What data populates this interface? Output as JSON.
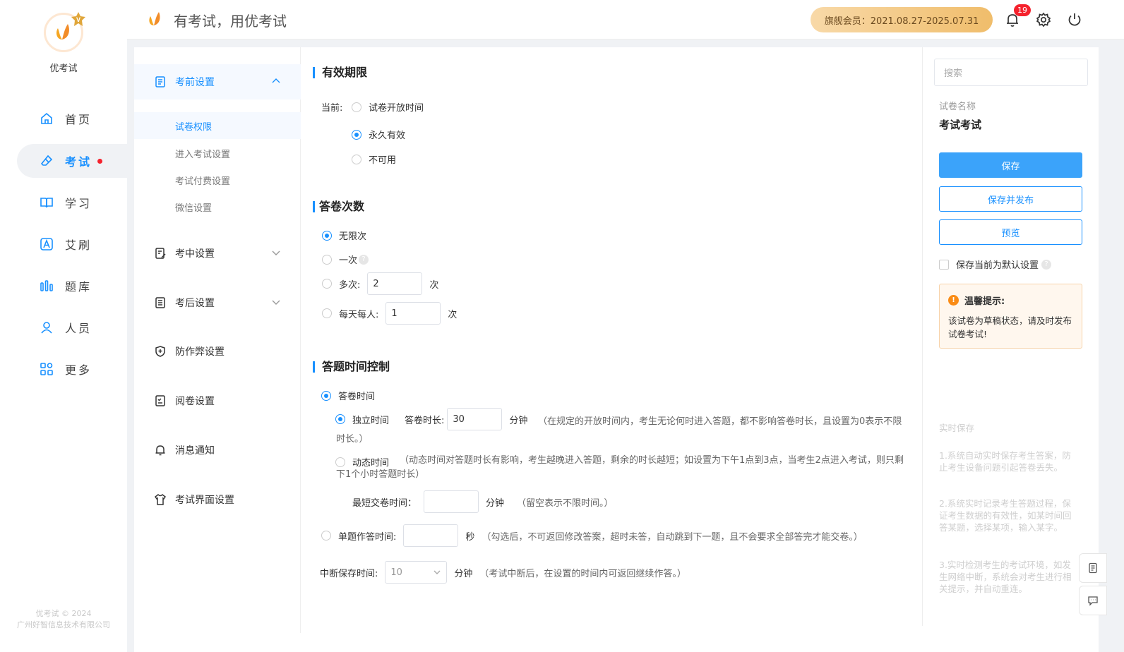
{
  "app": {
    "brand": "优考试",
    "slogan": "有考试，用优考试",
    "vip_text": "旗舰会员：2021.08.27-2025.07.31",
    "notification_count": "19",
    "copyright_line1": "优考试 © 2024",
    "copyright_line2": "广州好智信息技术有限公司",
    "accent_color": "#1890ff"
  },
  "nav": {
    "items": [
      {
        "label": "首页",
        "icon": "home-icon"
      },
      {
        "label": "考试",
        "icon": "eraser-icon"
      },
      {
        "label": "学习",
        "icon": "book-icon"
      },
      {
        "label": "艾刷",
        "icon": "a-icon"
      },
      {
        "label": "题库",
        "icon": "bar-chart-icon"
      },
      {
        "label": "人员",
        "icon": "user-icon"
      },
      {
        "label": "更多",
        "icon": "grid-icon"
      }
    ]
  },
  "submenu": {
    "before": "考前设置",
    "before_items": [
      "试卷权限",
      "进入考试设置",
      "考试付费设置",
      "微信设置"
    ],
    "during": "考中设置",
    "after": "考后设置",
    "anticheat": "防作弊设置",
    "grading": "阅卷设置",
    "notify": "消息通知",
    "ui": "考试界面设置"
  },
  "validity": {
    "title": "有效期限",
    "current_label": "当前:",
    "options": [
      "试卷开放时间",
      "永久有效",
      "不可用"
    ],
    "selected": "永久有效"
  },
  "attempts": {
    "title": "答卷次数",
    "unlimited": "无限次",
    "once": "一次",
    "multi": "多次:",
    "multi_value": "2",
    "multi_unit": "次",
    "daily": "每天每人:",
    "daily_value": "1",
    "daily_unit": "次",
    "selected": "无限次"
  },
  "timing": {
    "title": "答题时间控制",
    "answer_time": "答卷时间",
    "independent": "独立时间",
    "duration_label": "答卷时长:",
    "duration_value": "30",
    "duration_unit": "分钟",
    "independent_hint": "（在规定的开放时间内，考生无论何时进入答题，都不影响答卷时长，且设置为0表示不限时长。）",
    "dynamic": "动态时间",
    "dynamic_hint": "（动态时间对答题时长有影响，考生越晚进入答题，剩余的时长越短；如设置为下午1点到3点，当考生2点进入考试，则只剩下1个小时答题时长）",
    "min_submit_label": "最短交卷时间：",
    "min_submit_unit": "分钟",
    "min_submit_hint": "（留空表示不限时间。）",
    "single_q": "单题作答时间:",
    "single_q_unit": "秒",
    "single_q_hint": "（勾选后，不可返回修改答案，超时未答，自动跳到下一题，且不会要求全部答完才能交卷。）",
    "interrupt_label": "中断保存时间:",
    "interrupt_value": "10",
    "interrupt_unit": "分钟",
    "interrupt_hint": "（考试中断后，在设置的时间内可返回继续作答。）"
  },
  "right": {
    "search_placeholder": "搜索",
    "paper_name_label": "试卷名称",
    "paper_name": "考试考试",
    "save": "保存",
    "save_publish": "保存并发布",
    "preview": "预览",
    "default_label": "保存当前为默认设置",
    "tip_title": "温馨提示:",
    "tip_text": "该试卷为草稿状态，请及时发布试卷考试!",
    "realtime_title": "实时保存",
    "realtime_1": "1.系统自动实时保存考生答案，防止考生设备问题引起答卷丢失。",
    "realtime_2": "2.系统实时记录考生答题过程，保证考生数据的有效性，如某时间回答某题，选择某项，输入某字。",
    "realtime_3": "3.实时检测考生的考试环境，如发生网络中断，系统会对考生进行相关提示，并自动重连。"
  }
}
